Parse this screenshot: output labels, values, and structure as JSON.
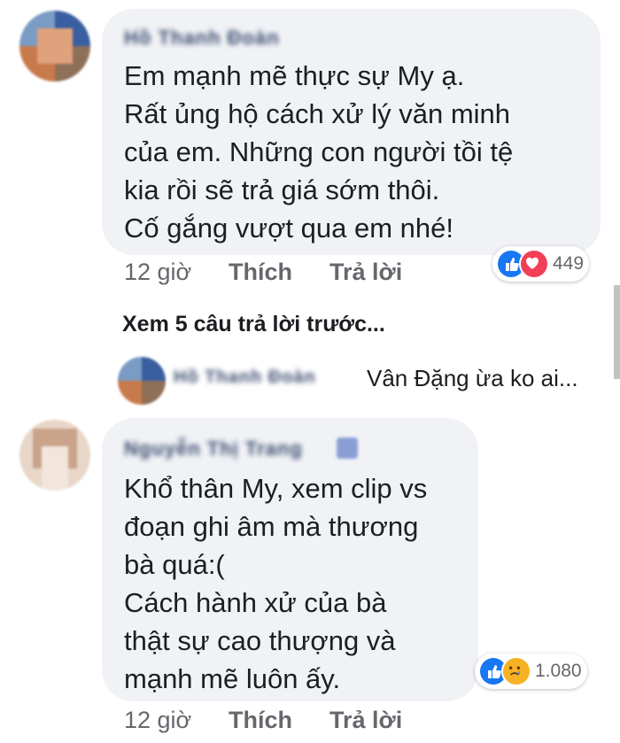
{
  "comments": [
    {
      "author": "Hồ Thanh Đoàn",
      "lines": [
        "Em mạnh mẽ thực sự My ạ.",
        "Rất ủng hộ cách xử lý văn minh",
        "của em. Những con người tồi tệ",
        "kia rồi sẽ trả giá sớm thôi.",
        "Cố gắng vượt qua em nhé!"
      ],
      "time": "12 giờ",
      "like_label": "Thích",
      "reply_label": "Trả lời",
      "reactions": {
        "icons": [
          "like-icon",
          "love-icon"
        ],
        "count": "449"
      }
    },
    {
      "author": "Nguyễn Thị Trang",
      "lines": [
        "Khổ thân My, xem clip vs",
        "đoạn ghi âm mà thương",
        "bà quá:(",
        "Cách hành xử của bà",
        "thật sự cao thượng và",
        "mạnh mẽ luôn ấy."
      ],
      "time": "12 giờ",
      "like_label": "Thích",
      "reply_label": "Trả lời",
      "reactions": {
        "icons": [
          "like-icon",
          "sad-icon"
        ],
        "count": "1.080"
      }
    }
  ],
  "view_previous_replies": "Xem 5 câu trả lời trước...",
  "reply_preview": {
    "author": "Hồ Thanh Đoàn",
    "text": "Vân Đặng  ừa ko ai..."
  },
  "colors": {
    "like_blue": "#1877f2",
    "love_red": "#f33e58",
    "sad_yellow": "#f7b125",
    "bubble_bg": "#f0f2f5",
    "meta_gray": "#65676b"
  }
}
